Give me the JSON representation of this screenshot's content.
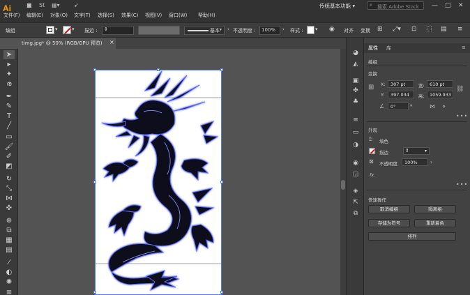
{
  "app": {
    "logo": "Ai",
    "workspace": "传统基本功能",
    "search_placeholder": "搜索 Adobe Stock",
    "minimize": "—",
    "maximize": "□",
    "close": "✕"
  },
  "menu": [
    "文件(F)",
    "编辑(E)",
    "对象(O)",
    "文字(T)",
    "选择(S)",
    "效果(C)",
    "视图(V)",
    "窗口(W)",
    "帮助(H)"
  ],
  "control_bar": {
    "group_label": "编组",
    "stroke_label": "描边 :",
    "stroke_profile": "基本",
    "opacity_label": "不透明度 :",
    "opacity_value": "100%",
    "style_label": "样式 :",
    "align_label": "对齐",
    "transform_label": "变换"
  },
  "document_tab": {
    "title": "timg.jpg* @ 50% (RGB/GPU 预览)",
    "close": "×"
  },
  "panel": {
    "tabs": [
      "属性",
      "库"
    ],
    "group_heading": "编组",
    "transform": {
      "heading": "变换",
      "x_label": "X:",
      "x_value": "307 pt",
      "y_label": "Y:",
      "y_value": "397.034",
      "w_label": "宽:",
      "w_value": "610 pt",
      "h_label": "高:",
      "h_value": "1059.933",
      "angle_value": "0°"
    },
    "appearance": {
      "heading": "外观",
      "fill_label": "填色",
      "stroke_label": "描边",
      "opacity_label": "不透明度",
      "opacity_value": "100%",
      "fx_label": "fx."
    },
    "quick_actions": {
      "heading": "快速操作",
      "buttons": [
        "取消编组",
        "隔离组",
        "存储为符号",
        "重新着色",
        "排列"
      ]
    },
    "more": "•••"
  },
  "colors": {
    "app_bg": "#535353",
    "menubar": "#323232",
    "logo": "#ff9a00",
    "dragon_dark": "#0a0a1e",
    "dragon_glow": "#5a6cff",
    "selection": "#4a7bff"
  }
}
